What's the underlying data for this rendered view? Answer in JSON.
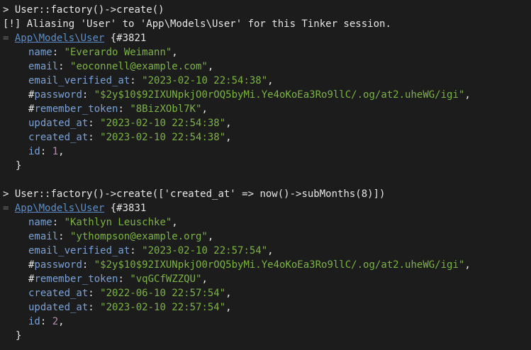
{
  "top_cut_text": "",
  "blocks": [
    {
      "prompt": ">",
      "command": "User::factory()->create()",
      "notice": "[!] Aliasing 'User' to 'App\\Models\\User' for this Tinker session.",
      "result_prefix": "=",
      "class_name": "App\\Models\\User",
      "object_id": "{#3821",
      "fields": [
        {
          "key": "name",
          "value": "\"Everardo Weimann\"",
          "type": "str",
          "suffix": ","
        },
        {
          "key": "email",
          "value": "\"eoconnell@example.com\"",
          "type": "str",
          "suffix": ","
        },
        {
          "key": "email_verified_at",
          "value": "\"2023-02-10 22:54:38\"",
          "type": "str",
          "suffix": ","
        },
        {
          "key": "#password",
          "value": "\"$2y$10$92IXUNpkjO0rOQ5byMi.Ye4oKoEa3Ro9llC/.og/at2.uheWG/igi\"",
          "type": "str",
          "suffix": ","
        },
        {
          "key": "#remember_token",
          "value": "\"8BizXObl7K\"",
          "type": "str",
          "suffix": ","
        },
        {
          "key": "updated_at",
          "value": "\"2023-02-10 22:54:38\"",
          "type": "str",
          "suffix": ","
        },
        {
          "key": "created_at",
          "value": "\"2023-02-10 22:54:38\"",
          "type": "str",
          "suffix": ","
        },
        {
          "key": "id",
          "value": "1",
          "type": "num",
          "suffix": ","
        }
      ],
      "closing": "}"
    },
    {
      "prompt": ">",
      "command": "User::factory()->create(['created_at' => now()->subMonths(8)])",
      "notice": "",
      "result_prefix": "=",
      "class_name": "App\\Models\\User",
      "object_id": "{#3831",
      "fields": [
        {
          "key": "name",
          "value": "\"Kathlyn Leuschke\"",
          "type": "str",
          "suffix": ","
        },
        {
          "key": "email",
          "value": "\"ythompson@example.org\"",
          "type": "str",
          "suffix": ","
        },
        {
          "key": "email_verified_at",
          "value": "\"2023-02-10 22:57:54\"",
          "type": "str",
          "suffix": ","
        },
        {
          "key": "#password",
          "value": "\"$2y$10$92IXUNpkjO0rOQ5byMi.Ye4oKoEa3Ro9llC/.og/at2.uheWG/igi\"",
          "type": "str",
          "suffix": ","
        },
        {
          "key": "#remember_token",
          "value": "\"vqGCfWZZQU\"",
          "type": "str",
          "suffix": ","
        },
        {
          "key": "created_at",
          "value": "\"2022-06-10 22:57:54\"",
          "type": "str",
          "suffix": ","
        },
        {
          "key": "updated_at",
          "value": "\"2023-02-10 22:57:54\"",
          "type": "str",
          "suffix": ","
        },
        {
          "key": "id",
          "value": "2",
          "type": "num",
          "suffix": ","
        }
      ],
      "closing": "}"
    }
  ],
  "colors": {
    "background": "#1c1c1c",
    "text": "#e6e6e6",
    "key": "#7aa2d6",
    "string": "#7cb342",
    "number": "#b48ead",
    "class_link": "#5b8ec9",
    "muted": "#6b6b6b"
  }
}
